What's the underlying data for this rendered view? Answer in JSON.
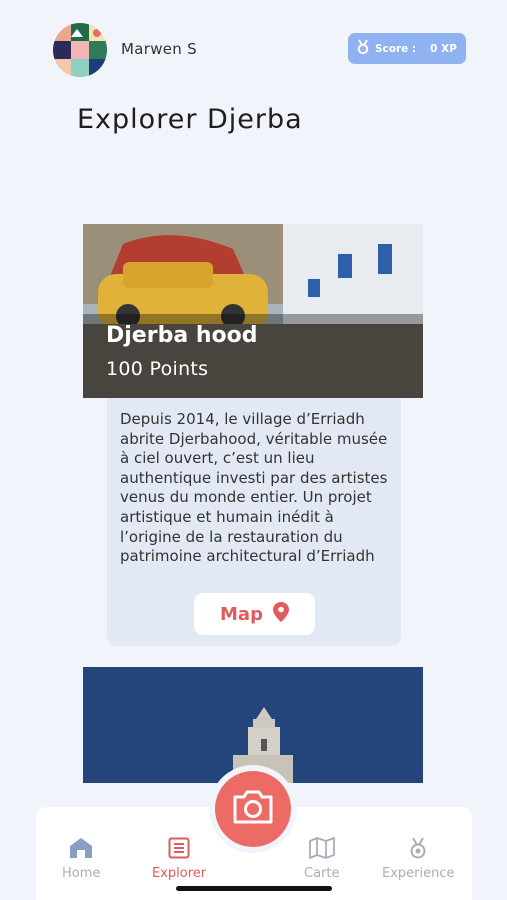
{
  "header": {
    "user_name": "Marwen S",
    "score_label": "Score :",
    "score_value": "0 XP",
    "page_title": "Explorer Djerba"
  },
  "card": {
    "title": "Djerba hood",
    "points": "100 Points",
    "description": "Depuis 2014, le village d’Erriadh abrite Djerbahood, véritable musée à ciel ouvert, c’est un lieu authentique investi par des artistes venus du monde entier. Un projet artistique et humain inédit à l’origine de la restauration du patrimoine architectural d’Erriadh",
    "map_label": "Map"
  },
  "nav": {
    "items": [
      {
        "label": "Home",
        "icon": "home-icon"
      },
      {
        "label": "Explorer",
        "icon": "list-icon"
      },
      {
        "label": "Carte",
        "icon": "map-icon"
      },
      {
        "label": "Experience",
        "icon": "medal-icon"
      }
    ],
    "active": "Explorer",
    "camera_icon": "camera-icon"
  },
  "colors": {
    "accent": "#e05b5b",
    "score_badge": "#8fb2f0",
    "background": "#f1f4fb"
  }
}
